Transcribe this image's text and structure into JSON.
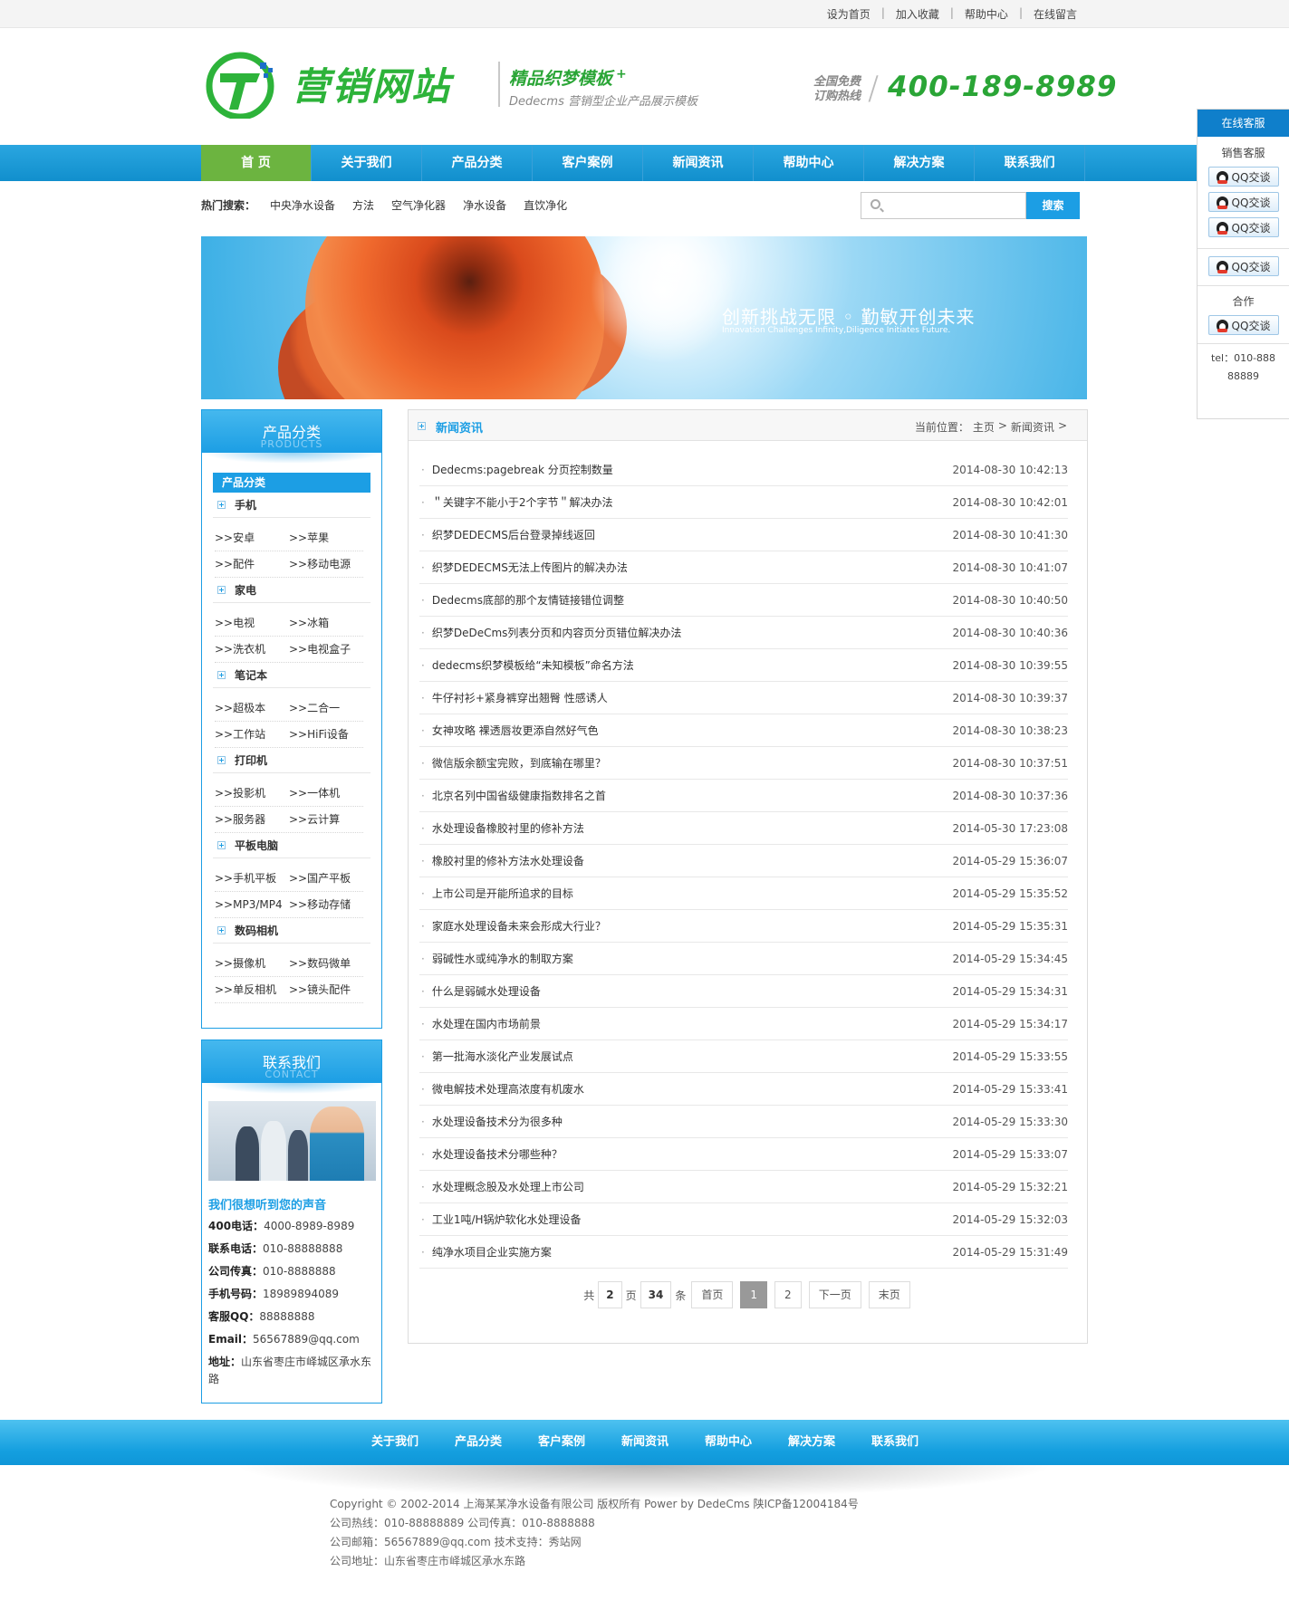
{
  "topbar": {
    "links": [
      "设为首页",
      "加入收藏",
      "帮助中心",
      "在线留言"
    ]
  },
  "header": {
    "logo_text": "营销网站",
    "slogan_title": "精品织梦模板",
    "slogan_plus": "+",
    "slogan_sub": "Dedecms 营销型企业产品展示模板",
    "hotline_label": "全国免费订购热线",
    "hotline_number": "400-189-8989",
    "brand_green": "#2db33a",
    "brand_blue": "#1c9ee4"
  },
  "nav": {
    "items": [
      "首 页",
      "关于我们",
      "产品分类",
      "客户案例",
      "新闻资讯",
      "帮助中心",
      "解决方案",
      "联系我们"
    ],
    "active_index": 0
  },
  "hot_search": {
    "label": "热门搜索：",
    "items": [
      "中央净水设备",
      "方法",
      "空气净化器",
      "净水设备",
      "直饮净化"
    ]
  },
  "search": {
    "placeholder": "",
    "button_label": "搜索"
  },
  "banner": {
    "title": "创新挑战无限 ◦ 勤敏开创未来",
    "subtitle": "Innovation Challenges Infinity,Diligence Initiates Future."
  },
  "products_box": {
    "title": "产品分类",
    "title_en": "PRODUCTS",
    "section_label": "产品分类",
    "groups": [
      {
        "name": "手机",
        "items": [
          [
            "安卓",
            "苹果"
          ],
          [
            "配件",
            "移动电源"
          ]
        ]
      },
      {
        "name": "家电",
        "items": [
          [
            "电视",
            "冰箱"
          ],
          [
            "洗衣机",
            "电视盒子"
          ]
        ]
      },
      {
        "name": "笔记本",
        "items": [
          [
            "超极本",
            "二合一"
          ],
          [
            "工作站",
            "HiFi设备"
          ]
        ]
      },
      {
        "name": "打印机",
        "items": [
          [
            "投影机",
            "一体机"
          ],
          [
            "服务器",
            "云计算"
          ]
        ]
      },
      {
        "name": "平板电脑",
        "items": [
          [
            "手机平板",
            "国产平板"
          ],
          [
            "MP3/MP4",
            "移动存储"
          ]
        ]
      },
      {
        "name": "数码相机",
        "items": [
          [
            "摄像机",
            "数码微单"
          ],
          [
            "单反相机",
            "镜头配件"
          ]
        ]
      }
    ],
    "item_prefix": ">>"
  },
  "contact_box": {
    "title": "联系我们",
    "title_en": "CONTACT",
    "heading": "我们很想听到您的声音",
    "lines": [
      {
        "label": "400电话：",
        "value": "4000-8989-8989"
      },
      {
        "label": "联系电话：",
        "value": "010-88888888"
      },
      {
        "label": "公司传真：",
        "value": "010-8888888"
      },
      {
        "label": "手机号码：",
        "value": "18989894089"
      },
      {
        "label": "客服QQ：",
        "value": "88888888"
      },
      {
        "label": "Email：",
        "value": "56567889@qq.com"
      },
      {
        "label": "地址：",
        "value": "山东省枣庄市峄城区承水东路"
      }
    ]
  },
  "main": {
    "title": "新闻资讯",
    "breadcrumb": [
      "当前位置：",
      "主页",
      ">",
      "新闻资讯",
      ">"
    ],
    "news": [
      {
        "title": "Dedecms:pagebreak 分页控制数量",
        "date": "2014-08-30 10:42:13"
      },
      {
        "title": "＂关键字不能小于2个字节＂解决办法",
        "date": "2014-08-30 10:42:01"
      },
      {
        "title": "织梦DEDECMS后台登录掉线返回",
        "date": "2014-08-30 10:41:30"
      },
      {
        "title": "织梦DEDECMS无法上传图片的解决办法",
        "date": "2014-08-30 10:41:07"
      },
      {
        "title": "Dedecms底部的那个友情链接错位调整",
        "date": "2014-08-30 10:40:50"
      },
      {
        "title": "织梦DeDeCms列表分页和内容页分页错位解决办法",
        "date": "2014-08-30 10:40:36"
      },
      {
        "title": "dedecms织梦模板给“未知模板”命名方法",
        "date": "2014-08-30 10:39:55"
      },
      {
        "title": "牛仔衬衫+紧身裤穿出翘臀 性感诱人",
        "date": "2014-08-30 10:39:37"
      },
      {
        "title": "女神攻略 裸透唇妆更添自然好气色",
        "date": "2014-08-30 10:38:23"
      },
      {
        "title": "微信版余额宝完败，到底输在哪里？",
        "date": "2014-08-30 10:37:51"
      },
      {
        "title": "北京名列中国省级健康指数排名之首",
        "date": "2014-08-30 10:37:36"
      },
      {
        "title": "水处理设备橡胶衬里的修补方法",
        "date": "2014-05-30 17:23:08"
      },
      {
        "title": "橡胶衬里的修补方法水处理设备",
        "date": "2014-05-29 15:36:07"
      },
      {
        "title": "上市公司是开能所追求的目标",
        "date": "2014-05-29 15:35:52"
      },
      {
        "title": "家庭水处理设备未来会形成大行业？",
        "date": "2014-05-29 15:35:31"
      },
      {
        "title": "弱碱性水或纯净水的制取方案",
        "date": "2014-05-29 15:34:45"
      },
      {
        "title": "什么是弱碱水处理设备",
        "date": "2014-05-29 15:34:31"
      },
      {
        "title": "水处理在国内市场前景",
        "date": "2014-05-29 15:34:17"
      },
      {
        "title": "第一批海水淡化产业发展试点",
        "date": "2014-05-29 15:33:55"
      },
      {
        "title": "微电解技术处理高浓度有机废水",
        "date": "2014-05-29 15:33:41"
      },
      {
        "title": "水处理设备技术分为很多种",
        "date": "2014-05-29 15:33:30"
      },
      {
        "title": "水处理设备技术分哪些种？",
        "date": "2014-05-29 15:33:07"
      },
      {
        "title": "水处理概念股及水处理上市公司",
        "date": "2014-05-29 15:32:21"
      },
      {
        "title": "工业1吨/H锅炉软化水处理设备",
        "date": "2014-05-29 15:32:03"
      },
      {
        "title": "纯净水项目企业实施方案",
        "date": "2014-05-29 15:31:49"
      }
    ],
    "pager": {
      "total_label": "共",
      "total_pages": "2",
      "pages_unit": "页",
      "total_items": "34",
      "items_unit": "条",
      "first": "首页",
      "current": "1",
      "next_num": "2",
      "next": "下一页",
      "last": "末页"
    }
  },
  "footer": {
    "nav": [
      "关于我们",
      "产品分类",
      "客户案例",
      "新闻资讯",
      "帮助中心",
      "解决方案",
      "联系我们"
    ],
    "lines": [
      "Copyright © 2002-2014 上海某某净水设备有限公司 版权所有 Power by DedeCms 陕ICP备12004184号",
      "公司热线：010-88888889   公司传真：010-8888888",
      "公司邮箱：56567889@qq.com   技术支持：秀站网",
      "公司地址：山东省枣庄市峄城区承水东路"
    ]
  },
  "service": {
    "title": "在线客服",
    "sales_label": "销售客服",
    "qq_label": "QQ交谈",
    "coop_label": "合作",
    "tel": "tel：010-88888889"
  }
}
